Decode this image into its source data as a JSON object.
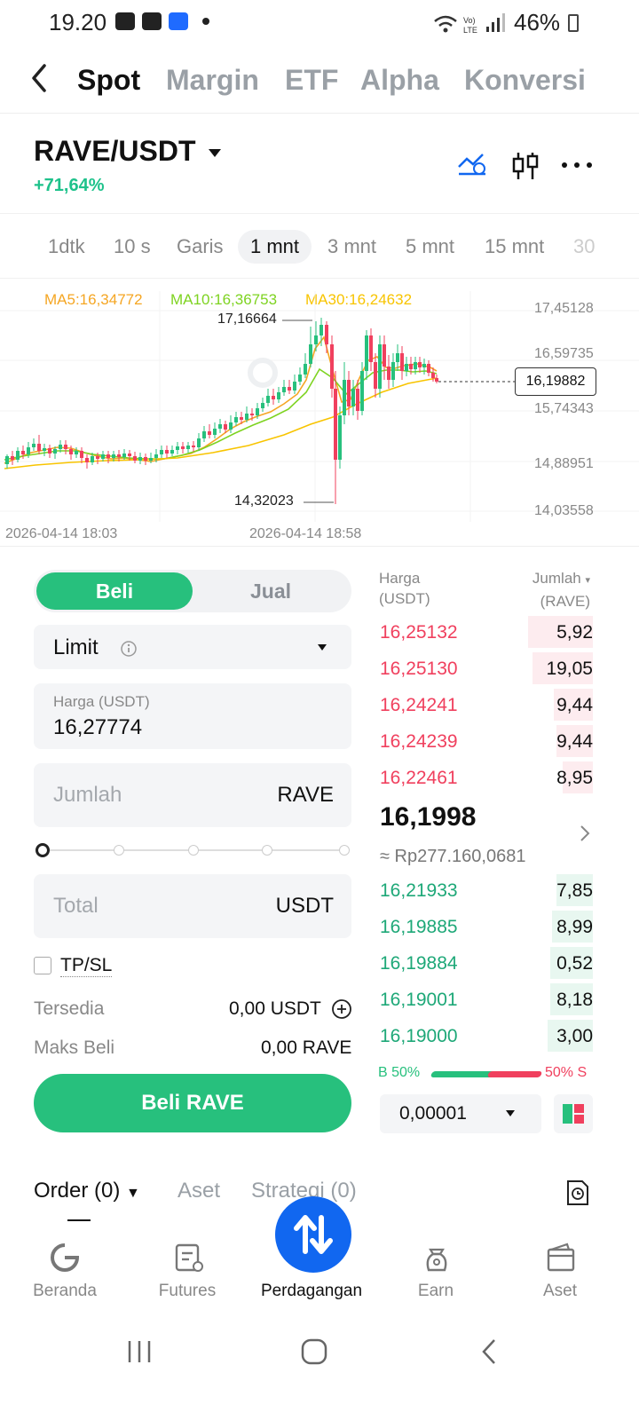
{
  "status_bar": {
    "time": "19.20",
    "battery": "46%"
  },
  "top_tabs": [
    "Spot",
    "Margin",
    "ETF",
    "Alpha",
    "Konversi"
  ],
  "pair": {
    "name": "RAVE/USDT",
    "change": "+71,64%"
  },
  "intervals": [
    "1dtk",
    "10 s",
    "Garis",
    "1 mnt",
    "3 mnt",
    "5 mnt",
    "15 mnt",
    "30"
  ],
  "chart": {
    "ma5": "MA5:16,34772",
    "ma10": "MA10:16,36753",
    "ma30": "MA30:16,24632",
    "y_ticks": [
      "17,45128",
      "16,59735",
      "15,74343",
      "14,88951",
      "14,03558"
    ],
    "high_label": "17,16664",
    "low_label": "14,32023",
    "last_price_tag": "16,19882",
    "x_ticks": [
      "2026-04-14 18:03",
      "2026-04-14 18:58"
    ],
    "colors": {
      "up": "#27c07d",
      "down": "#f0405e",
      "ma5": "#f5a623",
      "ma10": "#7ed321",
      "ma30": "#f8c400"
    }
  },
  "form": {
    "buy_label": "Beli",
    "sell_label": "Jual",
    "order_type": "Limit",
    "price_label": "Harga (USDT)",
    "price_value": "16,27774",
    "amount_placeholder": "Jumlah",
    "amount_unit": "RAVE",
    "total_placeholder": "Total",
    "total_unit": "USDT",
    "tpsl": "TP/SL",
    "available_label": "Tersedia",
    "available_value": "0,00 USDT",
    "max_buy_label": "Maks Beli",
    "max_buy_value": "0,00 RAVE",
    "submit": "Beli RAVE"
  },
  "orderbook": {
    "price_header_1": "Harga",
    "price_header_2": "(USDT)",
    "qty_header_1": "Jumlah",
    "qty_header_2": "(RAVE)",
    "asks": [
      {
        "price": "16,25132",
        "qty": "5,92",
        "depth": 0.3
      },
      {
        "price": "16,25130",
        "qty": "19,05",
        "depth": 0.28
      },
      {
        "price": "16,24241",
        "qty": "9,44",
        "depth": 0.18
      },
      {
        "price": "16,24239",
        "qty": "9,44",
        "depth": 0.17
      },
      {
        "price": "16,22461",
        "qty": "8,95",
        "depth": 0.14
      }
    ],
    "last_price": "16,1998",
    "last_idr": "≈ Rp277.160,0681",
    "bids": [
      {
        "price": "16,21933",
        "qty": "7,85",
        "depth": 0.17
      },
      {
        "price": "16,19885",
        "qty": "8,99",
        "depth": 0.19
      },
      {
        "price": "16,19884",
        "qty": "0,52",
        "depth": 0.2
      },
      {
        "price": "16,19001",
        "qty": "8,18",
        "depth": 0.2
      },
      {
        "price": "16,19000",
        "qty": "3,00",
        "depth": 0.21
      }
    ],
    "buy_ratio": "B 50%",
    "sell_ratio": "50% S",
    "tick_size": "0,00001"
  },
  "orders_tabs": [
    "Order (0)",
    "Aset",
    "Strategi (0)"
  ],
  "bottom_nav": [
    "Beranda",
    "Futures",
    "Perdagangan",
    "Earn",
    "Aset"
  ]
}
